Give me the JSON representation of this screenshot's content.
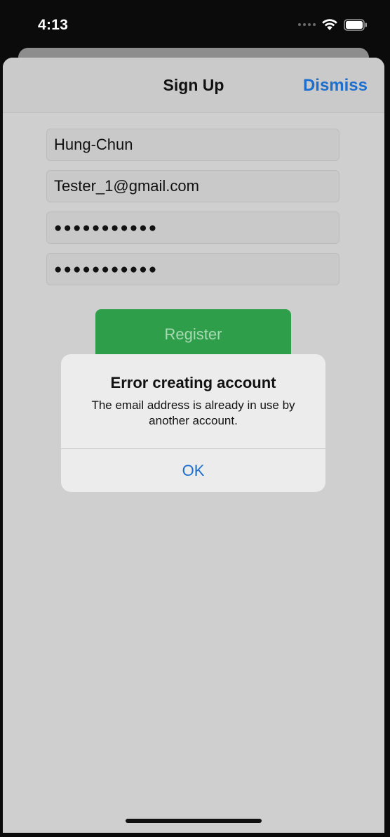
{
  "status_bar": {
    "time": "4:13"
  },
  "nav": {
    "title": "Sign Up",
    "dismiss_label": "Dismiss"
  },
  "form": {
    "name_value": "Hung-Chun",
    "email_value": "Tester_1@gmail.com",
    "password_value": "●●●●●●●●●●●",
    "confirm_password_value": "●●●●●●●●●●●",
    "register_label": "Register"
  },
  "alert": {
    "title": "Error creating account",
    "message": "The email address is already in use by another account.",
    "ok_label": "OK"
  },
  "colors": {
    "accent": "#1d6fcf",
    "register_button": "#2e9e4b"
  },
  "icons": [
    "cellular-signal-icon",
    "wifi-icon",
    "battery-icon"
  ]
}
